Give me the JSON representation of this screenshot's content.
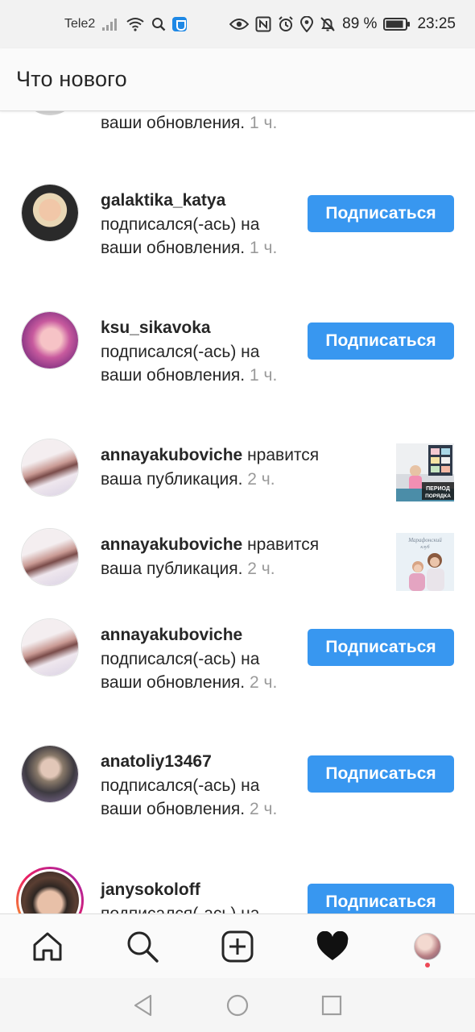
{
  "status_bar": {
    "carrier": "Tele2",
    "battery": "89 %",
    "time": "23:25"
  },
  "header": {
    "title": "Что нового"
  },
  "feed": {
    "top_partial": {
      "text": "ваши обновления.",
      "time": "1 ч."
    },
    "items": [
      {
        "username": "galaktika_katya",
        "action": "подписался(-ась) на ваши обновления.",
        "time": "1 ч.",
        "button": "Подписаться"
      },
      {
        "username": "ksu_sikavoka",
        "action": "подписался(-ась) на ваши обновления.",
        "time": "1 ч.",
        "button": "Подписаться"
      },
      {
        "username": "annayakuboviche",
        "action": "нравится ваша публикация.",
        "time": "2 ч.",
        "thumb_text": "ПЕРИОД ПОРЯДКА"
      },
      {
        "username": "annayakuboviche",
        "action": "нравится ваша публикация.",
        "time": "2 ч.",
        "thumb_text": "Марафонский клуб"
      },
      {
        "username": "annayakuboviche",
        "action": "подписался(-ась) на ваши обновления.",
        "time": "2 ч.",
        "button": "Подписаться"
      },
      {
        "username": "anatoliy13467",
        "action": "подписался(-ась) на ваши обновления.",
        "time": "2 ч.",
        "button": "Подписаться"
      },
      {
        "username": "janysokoloff",
        "action": "подписался(-ась) на",
        "button": "Подписаться"
      }
    ]
  },
  "bottom_nav": {
    "items": [
      "home-icon",
      "search-icon",
      "add-post-icon",
      "heart-icon",
      "profile-avatar"
    ]
  },
  "colors": {
    "accent": "#3897f0",
    "notification_dot": "#ed4956"
  }
}
